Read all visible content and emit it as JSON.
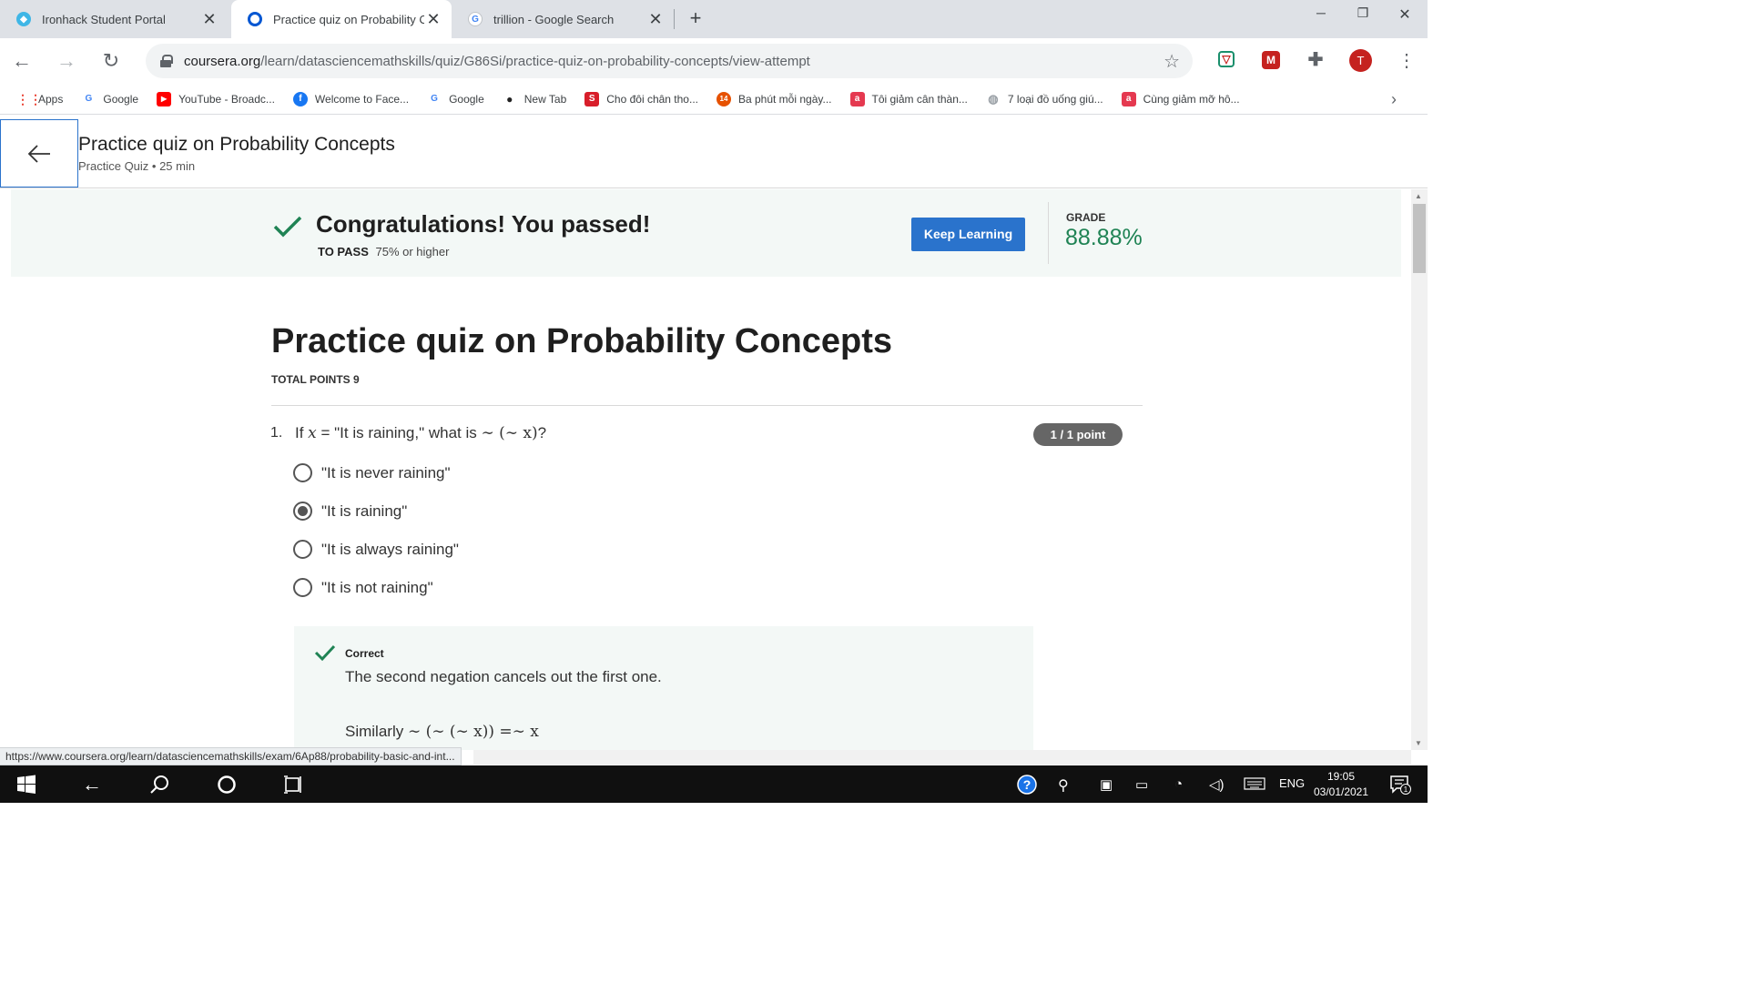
{
  "browser": {
    "tabs": [
      {
        "title": "Ironhack Student Portal",
        "icon": "ironhack-icon",
        "active": false
      },
      {
        "title": "Practice quiz on Probability Co",
        "icon": "coursera-icon",
        "active": true
      },
      {
        "title": "trillion - Google Search",
        "icon": "google-icon",
        "active": false
      }
    ],
    "url_host": "coursera.org",
    "url_path": "/learn/datasciencemathskills/quiz/G86Si/practice-quiz-on-probability-concepts/view-attempt",
    "profile_initial": "T",
    "bookmarks": [
      {
        "label": "Apps",
        "icon": "apps-grid-icon"
      },
      {
        "label": "Google",
        "icon": "google-icon"
      },
      {
        "label": "YouTube - Broadc...",
        "icon": "youtube-icon"
      },
      {
        "label": "Welcome to Face...",
        "icon": "facebook-icon"
      },
      {
        "label": "Google",
        "icon": "google-icon"
      },
      {
        "label": "New Tab",
        "icon": "github-icon"
      },
      {
        "label": "Cho đôi chân tho...",
        "icon": "s-icon"
      },
      {
        "label": "Ba phút mỗi ngày...",
        "icon": "14-icon"
      },
      {
        "label": "Tôi giảm cân thàn...",
        "icon": "a-icon"
      },
      {
        "label": "7 loại đồ uống giú...",
        "icon": "globe-icon"
      },
      {
        "label": "Cùng giảm mỡ hô...",
        "icon": "a-icon"
      }
    ]
  },
  "header": {
    "title": "Practice quiz on Probability Concepts",
    "subtitle": "Practice Quiz • 25 min"
  },
  "result": {
    "message": "Congratulations! You passed!",
    "to_pass_label": "TO PASS",
    "to_pass_value": "75% or higher",
    "keep_learning": "Keep Learning",
    "grade_label": "GRADE",
    "grade_value": "88.88%"
  },
  "quiz": {
    "title": "Practice quiz on Probability Concepts",
    "total_points": "TOTAL POINTS 9",
    "question": {
      "number": "1.",
      "text_before": "If ",
      "var": "x",
      "text_mid": " = \"It is raining,\" what is ",
      "expr": "∼ (∼ x)",
      "text_after": "?",
      "points": "1 / 1 point",
      "options": [
        {
          "label": "\"It is never raining\"",
          "checked": false
        },
        {
          "label": "\"It is raining\"",
          "checked": true
        },
        {
          "label": "\"It is always raining\"",
          "checked": false
        },
        {
          "label": "\"It is not raining\"",
          "checked": false
        }
      ],
      "feedback_label": "Correct",
      "feedback_text": "The second negation cancels out the first one.",
      "feedback_similarly": "Similarly ",
      "feedback_expr": "∼ (∼ (∼ x)) =∼ x"
    }
  },
  "status_url": "https://www.coursera.org/learn/datasciencemathskills/exam/6Ap88/probability-basic-and-int...",
  "taskbar": {
    "language": "ENG",
    "time": "19:05",
    "date": "03/01/2021",
    "notifications": "1"
  },
  "colors": {
    "accent": "#2a73cc",
    "success": "#1f8354",
    "banner_bg": "#f3f8f6"
  }
}
